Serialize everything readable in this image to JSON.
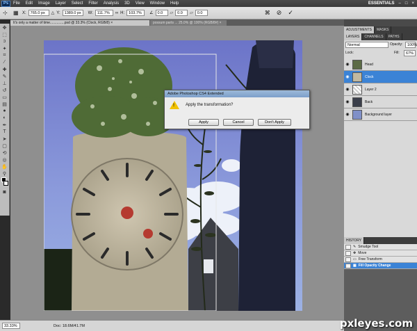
{
  "app": {
    "logo": "Ps",
    "workspace_label": "ESSENTIALS"
  },
  "menu": [
    "File",
    "Edit",
    "Image",
    "Layer",
    "Select",
    "Filter",
    "Analysis",
    "3D",
    "View",
    "Window",
    "Help"
  ],
  "options": {
    "x": "765.0 px",
    "y": "1389.0 px",
    "w": "111.7%",
    "h": "103.7%",
    "angle": "0.0",
    "h_skew": "0.0",
    "v_skew": "0.0",
    "x_label": "X:",
    "y_label": "Y:",
    "w_label": "W:",
    "h_label": "H:",
    "zoom_field": "100%"
  },
  "tabs": [
    {
      "label": "It's only a matter of time...............psd @ 33.3% (Clock, RGB/8) ×",
      "active": true
    },
    {
      "label": "possum parts ... 25.0% @ 100% (RGB/8#) ×",
      "active": false
    }
  ],
  "dialog": {
    "title": "Adobe Photoshop CS4 Extended",
    "message": "Apply the transformation?",
    "buttons": {
      "apply": "Apply",
      "cancel": "Cancel",
      "dont_apply": "Don't Apply"
    }
  },
  "panels": {
    "top_tabs": [
      "ADJUSTMENTS",
      "MASKS"
    ],
    "layer_tabs": [
      "LAYERS",
      "CHANNELS",
      "PATHS"
    ],
    "blend_mode": "Normal",
    "opacity_label": "Opacity:",
    "opacity": "100%",
    "fill_label": "Fill:",
    "fill": "67%",
    "lock_label": "Lock:",
    "layers": [
      {
        "name": "Head",
        "selected": false
      },
      {
        "name": "Clock",
        "selected": true
      },
      {
        "name": "Layer 2",
        "selected": false
      },
      {
        "name": "Back",
        "selected": false
      },
      {
        "name": "Background layer",
        "selected": false
      }
    ],
    "history_tab": "HISTORY",
    "history": [
      {
        "name": "Smudge Tool",
        "selected": false
      },
      {
        "name": "Move",
        "selected": false
      },
      {
        "name": "Free Transform",
        "selected": false
      },
      {
        "name": "Fill Opacity Change",
        "selected": true
      }
    ]
  },
  "status": {
    "zoom": "33.33%",
    "doc": "Doc: 18.6M/41.7M"
  },
  "watermark": "pxleyes.com",
  "colors": {
    "selection": "#3b83d6",
    "sky": "#6f7fbf"
  }
}
